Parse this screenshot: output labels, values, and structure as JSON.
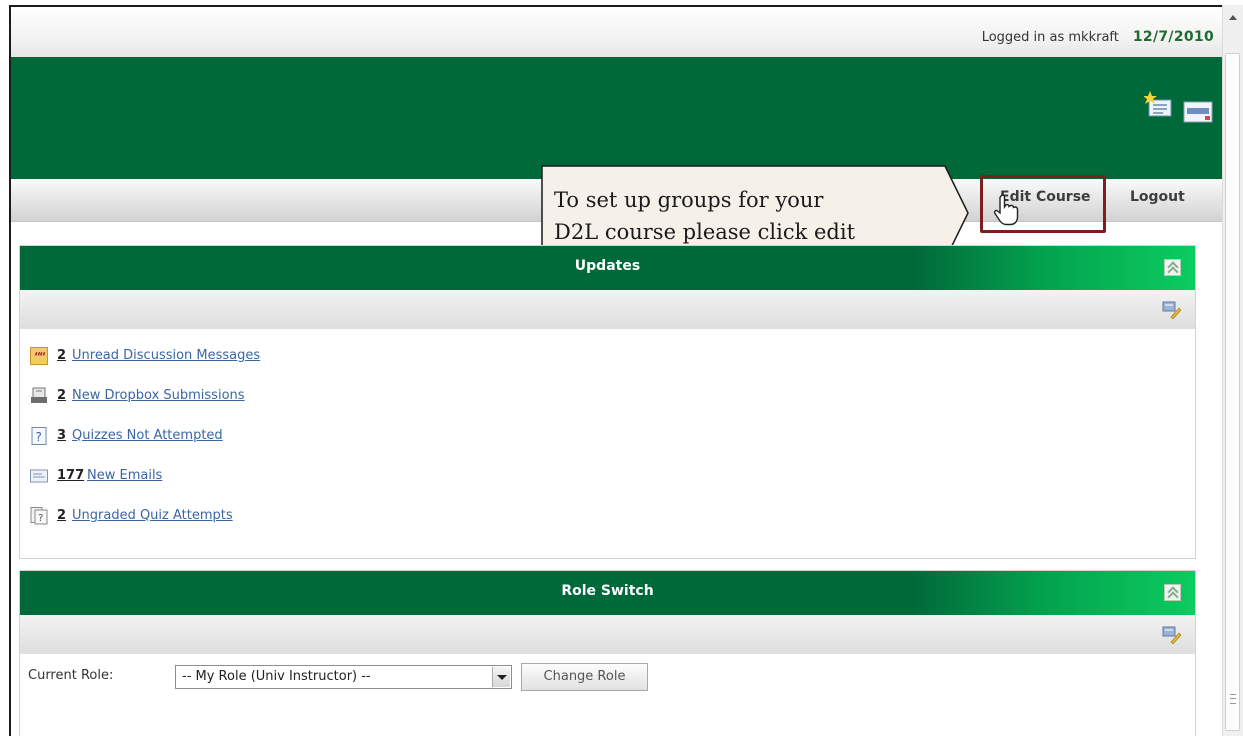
{
  "header": {
    "logged_in_text": "Logged in as mkkraft",
    "date": "12/7/2010"
  },
  "nav": {
    "edit_course": "Edit Course",
    "logout": "Logout"
  },
  "callout": {
    "line1": "To set up groups for your",
    "line2": "D2L course please click edit"
  },
  "updates": {
    "title": "Updates",
    "items": [
      {
        "count": "2",
        "label": "Unread Discussion Messages",
        "icon": "discussion-icon"
      },
      {
        "count": "2",
        "label": "New Dropbox Submissions",
        "icon": "dropbox-icon"
      },
      {
        "count": "3",
        "label": "Quizzes Not Attempted",
        "icon": "quiz-icon"
      },
      {
        "count": "177",
        "label": "New Emails",
        "icon": "email-icon"
      },
      {
        "count": "2",
        "label": "Ungraded Quiz Attempts",
        "icon": "ungraded-quiz-icon"
      }
    ]
  },
  "role_switch": {
    "title": "Role Switch",
    "current_role_label": "Current Role:",
    "selected_role": "-- My Role (Univ Instructor) --",
    "change_button": "Change Role"
  },
  "colors": {
    "header_green": "#00693a",
    "date_green": "#1e6b32",
    "link_blue": "#3a66a3",
    "highlight_border": "#7b1f1f"
  }
}
